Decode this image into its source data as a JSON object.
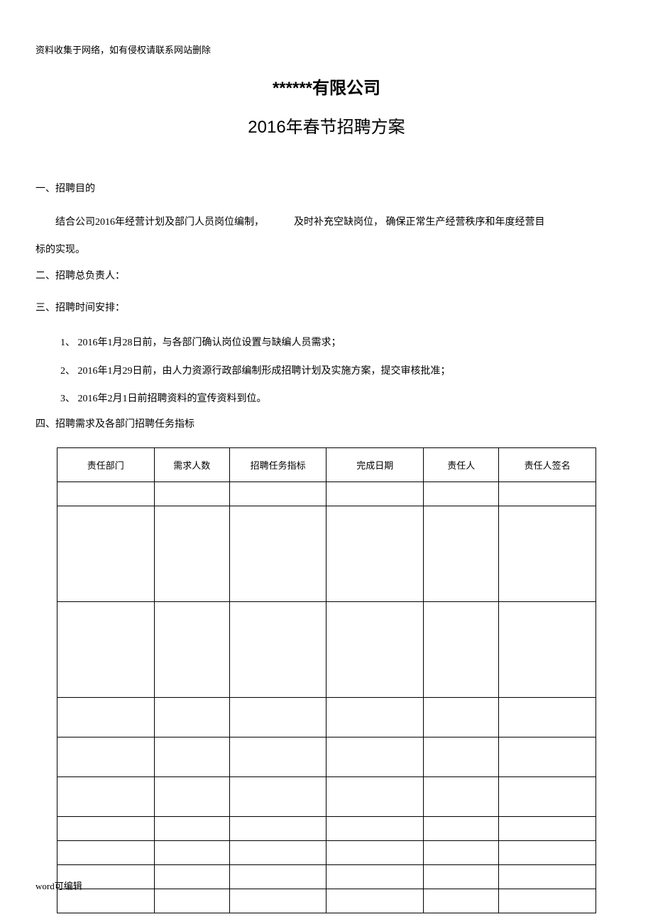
{
  "header_note": "资料收集于网络，如有侵权请联系网站删除",
  "title_1": "******有限公司",
  "title_2": "2016年春节招聘方案",
  "section_1": {
    "heading": "一、招聘目的",
    "para_a": "结合公司2016年经营计划及部门人员岗位编制，",
    "para_b": "及时补充空缺岗位， 确保正常生产经营秩序和年度经营目",
    "para_c": "标的实现。"
  },
  "section_2": {
    "heading": "二、招聘总负责人："
  },
  "section_3": {
    "heading": "三、招聘时间安排：",
    "items": [
      "1、 2016年1月28日前，与各部门确认岗位设置与缺编人员需求；",
      "2、 2016年1月29日前，由人力资源行政部编制形成招聘计划及实施方案，提交审核批准；",
      "3、 2016年2月1日前招聘资料的宣传资料到位。"
    ]
  },
  "section_4": {
    "heading": "四、招聘需求及各部门招聘任务指标"
  },
  "table": {
    "headers": [
      "责任部门",
      "需求人数",
      "招聘任务指标",
      "完成日期",
      "责任人",
      "责任人签名"
    ]
  },
  "footer_note": "word可编辑"
}
